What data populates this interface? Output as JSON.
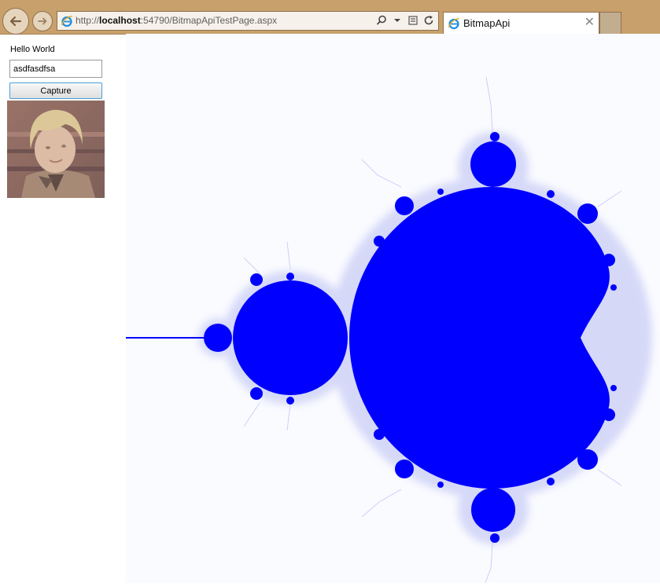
{
  "browser": {
    "url_prefix": "http://",
    "url_host": "localhost",
    "url_rest": ":54790/BitmapApiTestPage.aspx",
    "tab_title": "BitmapApi",
    "tab_close_glyph": "✕"
  },
  "page": {
    "greeting": "Hello World",
    "input_value": "asdfasdfsa",
    "capture_label": "Capture"
  },
  "icons": [
    "back-icon",
    "forward-icon",
    "ie-icon",
    "search-icon",
    "dropdown-icon",
    "compat-icon",
    "refresh-icon",
    "close-icon"
  ],
  "colors": {
    "chrome": "#c8a06b",
    "fractal": "#0000ff",
    "fractal_fringe": "#b8bdf2"
  }
}
